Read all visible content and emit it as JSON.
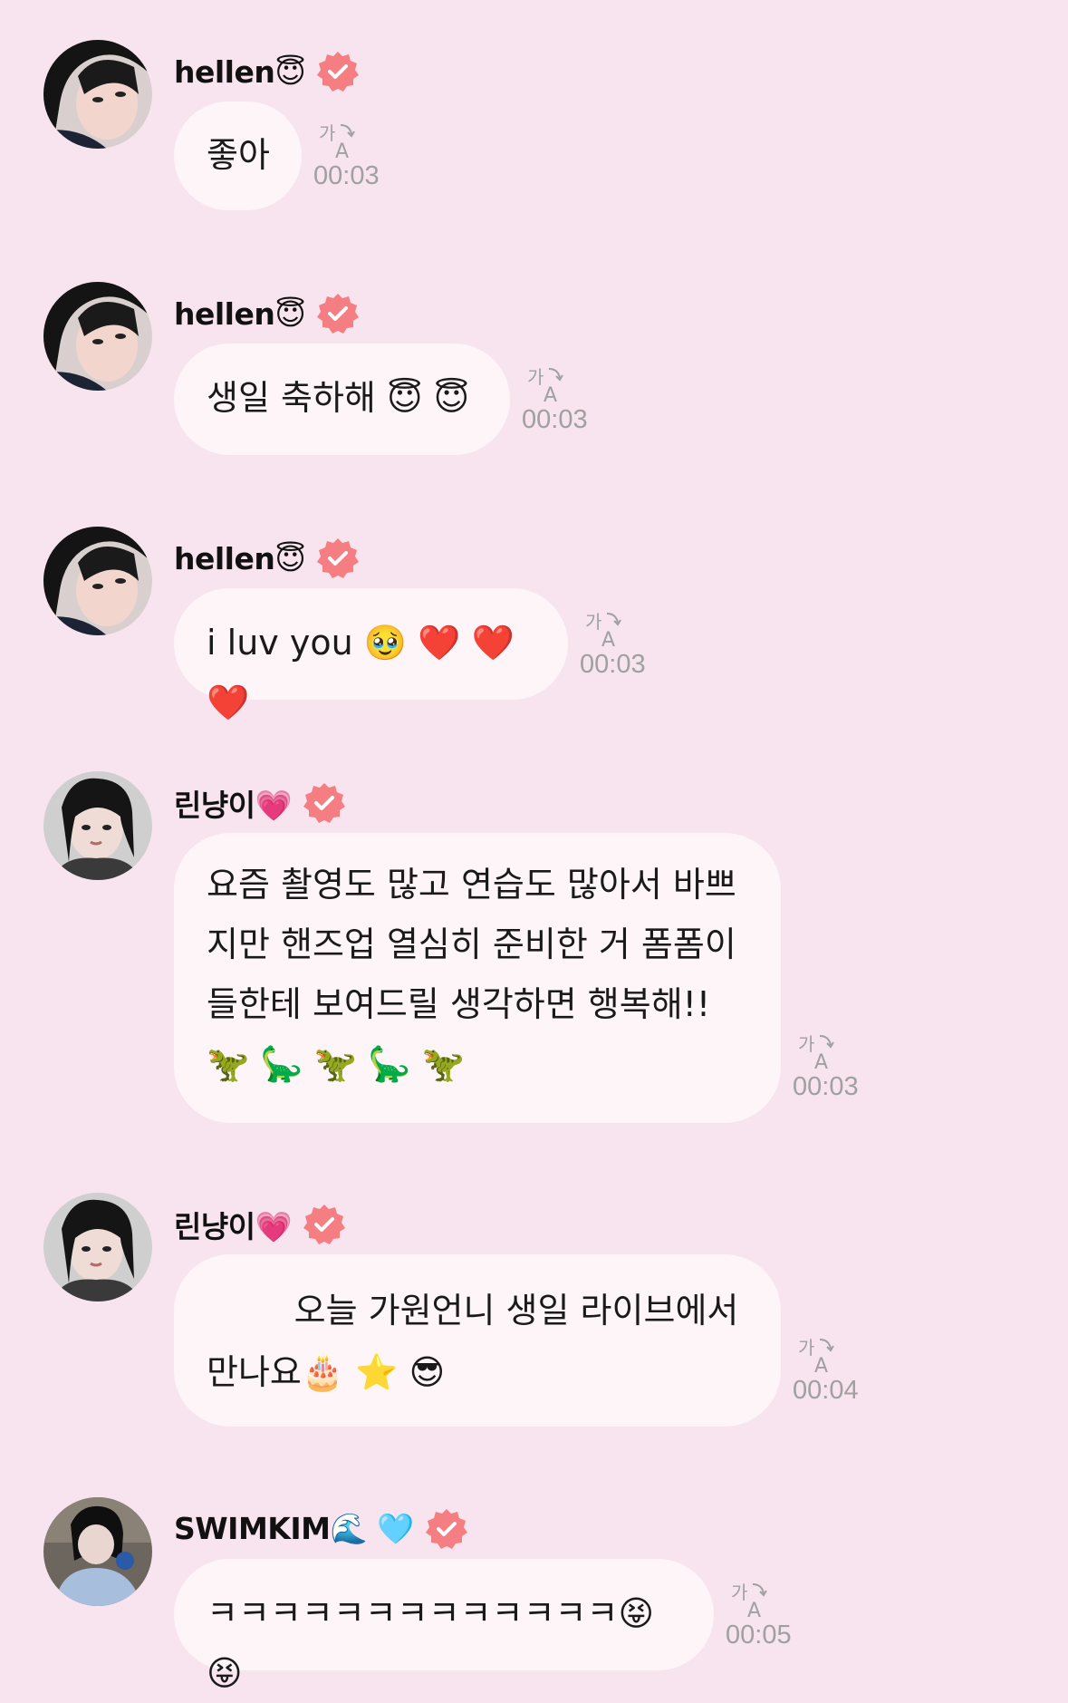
{
  "colors": {
    "background": "#f8e4ee",
    "bubble": "#fdf5f8",
    "verified_badge": "#f57e83",
    "timestamp": "#a0a0a0"
  },
  "icons": {
    "verified": "verified-badge-icon",
    "translate": "translate-icon"
  },
  "messages": [
    {
      "sender": "hellen😇",
      "text": "좋아",
      "time": "00:03"
    },
    {
      "sender": "hellen😇",
      "text": "생일 축하해 😇 😇",
      "time": "00:03"
    },
    {
      "sender": "hellen😇",
      "text": "i luv you 🥹 ❤️ ❤️ ❤️",
      "time": "00:03"
    },
    {
      "sender": "린냥이💗",
      "text": "요즘 촬영도 많고 연습도 많아서 바쁘\n지만 핸즈업 열심히 준비한 거 폼폼이\n들한테 보여드릴 생각하면 행복해!!\n🦖 🦕 🦖 🦕 🦖",
      "time": "00:03"
    },
    {
      "sender": "린냥이💗",
      "text": "        오늘 가원언니 생일 라이브에서\n만나요🎂 ⭐️ 😎",
      "time": "00:04"
    },
    {
      "sender": "SWIMKIM🌊 🩵",
      "text": "ㅋㅋㅋㅋㅋㅋㅋㅋㅋㅋㅋㅋㅋ😝 😝",
      "time": "00:05"
    }
  ]
}
